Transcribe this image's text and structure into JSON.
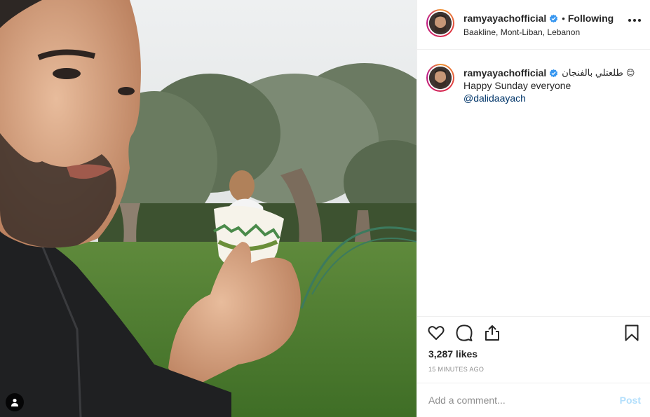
{
  "post": {
    "username": "ramyayachofficial",
    "following_label": "Following",
    "separator": "•",
    "location": "Baakline, Mont-Liban, Lebanon",
    "caption_arabic": "طلعتلي بالفنجان",
    "caption_emoji": "😊",
    "caption_line2": "Happy Sunday everyone",
    "mention": "@dalidaayach",
    "likes": "3,287 likes",
    "time": "15 MINUTES AGO",
    "comment_placeholder": "Add a comment...",
    "post_label": "Post"
  },
  "icons": {
    "verified": "verified-badge-icon",
    "more": "more-options-icon",
    "like": "heart-icon",
    "comment": "comment-icon",
    "share": "share-icon",
    "save": "bookmark-icon",
    "tag": "user-tag-icon"
  },
  "colors": {
    "verified": "#3897f0",
    "mention": "#003569",
    "post_disabled": "#b2dffc",
    "meta": "#8e8e8e"
  }
}
